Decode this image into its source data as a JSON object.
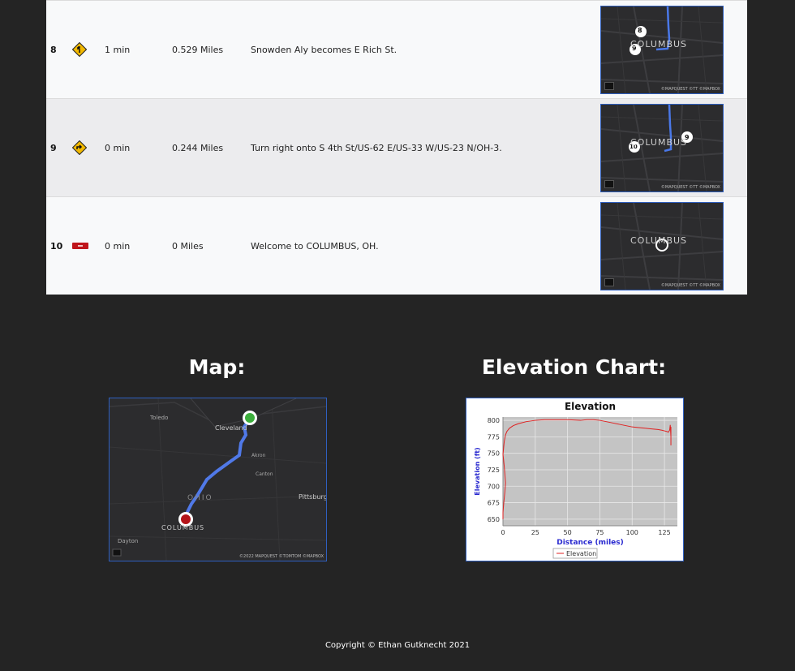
{
  "directions": [
    {
      "step": "8",
      "icon": "bear-left-sign-icon",
      "time": "1 min",
      "distance": "0.529 Miles",
      "instruction": "Snowden Aly becomes E Rich St.",
      "thumb_city": "COLUMBUS",
      "thumb_markers": [
        "8",
        "9"
      ],
      "thumb_credit": "©MAPQUEST ©TT ©MAPBOX"
    },
    {
      "step": "9",
      "icon": "turn-right-sign-icon",
      "time": "0 min",
      "distance": "0.244 Miles",
      "instruction": "Turn right onto S 4th St/US-62 E/US-33 W/US-23 N/OH-3.",
      "thumb_city": "COLUMBUS",
      "thumb_markers": [
        "10",
        "9"
      ],
      "thumb_credit": "©MAPQUEST ©TT ©MAPBOX"
    },
    {
      "step": "10",
      "icon": "destination-flag-icon",
      "time": "0 min",
      "distance": "0 Miles",
      "instruction": "Welcome to COLUMBUS, OH.",
      "thumb_city": "COLUMBUS",
      "thumb_markers": [],
      "thumb_credit": "©MAPQUEST ©TT ©MAPBOX"
    }
  ],
  "map_section": {
    "heading": "Map:",
    "labels": {
      "toledo": "Toledo",
      "cleveland": "Cleveland",
      "akron": "Akron",
      "canton": "Canton",
      "ohio": "OHIO",
      "pittsburgh": "Pittsburg",
      "columbus": "COLUMBUS",
      "dayton": "Dayton"
    },
    "credit": "©2022 MAPQUEST ©TOMTOM ©MAPBOX"
  },
  "elevation_section": {
    "heading": "Elevation Chart:"
  },
  "chart_data": {
    "type": "line",
    "title": "Elevation",
    "xlabel": "Distance (miles)",
    "ylabel": "Elevation (ft)",
    "xlim": [
      0,
      135
    ],
    "ylim": [
      640,
      805
    ],
    "xticks": [
      0,
      25,
      50,
      75,
      100,
      125
    ],
    "yticks": [
      650,
      675,
      700,
      725,
      750,
      775,
      800
    ],
    "grid": true,
    "legend": "bottom-center",
    "series": [
      {
        "name": "Elevation",
        "color": "#e02020",
        "x": [
          0.0,
          0.0,
          0.5,
          1.0,
          1.5,
          2.0,
          1.5,
          1.0,
          0.5,
          0.0,
          0.5,
          1.0,
          2.0,
          3,
          5,
          8,
          12,
          18,
          25,
          32,
          40,
          50,
          60,
          65,
          70,
          75,
          80,
          85,
          90,
          95,
          100,
          105,
          110,
          115,
          120,
          123,
          125,
          127,
          128,
          129,
          129.5,
          130,
          130,
          130,
          130
        ],
        "y": [
          650,
          660,
          672,
          682,
          692,
          705,
          718,
          730,
          740,
          748,
          758,
          768,
          778,
          783,
          788,
          792,
          795,
          798,
          800,
          801,
          801,
          801,
          800,
          801,
          801,
          800,
          798,
          796,
          794,
          792,
          790,
          789,
          788,
          787,
          786,
          785,
          784,
          783,
          782,
          785,
          793,
          775,
          762,
          790,
          780
        ]
      }
    ]
  },
  "footer": {
    "text": "Copyright © Ethan Gutknecht 2021"
  }
}
